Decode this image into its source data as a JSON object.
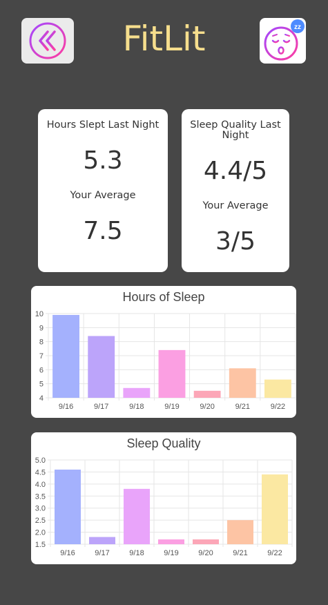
{
  "app": {
    "title": "FitLit"
  },
  "header": {
    "back_icon": "double-chevron-left-icon",
    "sleep_icon": "sleeping-face-icon",
    "sleep_badge": "zz"
  },
  "colors": {
    "background": "#474747",
    "title": "#f6de8d",
    "card": "#ffffff",
    "gradient_start": "#a347ff",
    "gradient_end": "#ff3da0",
    "badge": "#4d8bff"
  },
  "hours_card": {
    "label": "Hours Slept Last Night",
    "value": "5.3",
    "average_label": "Your Average",
    "average_value": "7.5"
  },
  "quality_card": {
    "label": "Sleep Quality Last Night",
    "value": "4.4/5",
    "average_label": "Your Average",
    "average_value": "3/5"
  },
  "chart_data": [
    {
      "type": "bar",
      "title": "Hours of Sleep",
      "categories": [
        "9/16",
        "9/17",
        "9/18",
        "9/19",
        "9/20",
        "9/21",
        "9/22"
      ],
      "values": [
        9.9,
        8.4,
        4.7,
        7.4,
        4.5,
        6.1,
        5.3
      ],
      "ylim": [
        4,
        10
      ],
      "yticks": [
        "4",
        "5",
        "6",
        "7",
        "8",
        "9",
        "10"
      ],
      "grid": true,
      "colors": [
        "#a4b1fd",
        "#bca4fa",
        "#e9a4fa",
        "#fb9fe2",
        "#fca6b7",
        "#fdc4a4",
        "#fbe8a2"
      ]
    },
    {
      "type": "bar",
      "title": "Sleep Quality",
      "categories": [
        "9/16",
        "9/17",
        "9/18",
        "9/19",
        "9/20",
        "9/21",
        "9/22"
      ],
      "values": [
        4.6,
        1.8,
        3.8,
        1.7,
        1.7,
        2.5,
        4.4
      ],
      "ylim": [
        1.5,
        5.0
      ],
      "yticks": [
        "1.5",
        "2.0",
        "2.5",
        "3.0",
        "3.5",
        "4.0",
        "4.5",
        "5.0"
      ],
      "grid": true,
      "colors": [
        "#a4b1fd",
        "#bca4fa",
        "#e9a4fa",
        "#fb9fe2",
        "#fca6b7",
        "#fdc4a4",
        "#fbe8a2"
      ]
    }
  ]
}
